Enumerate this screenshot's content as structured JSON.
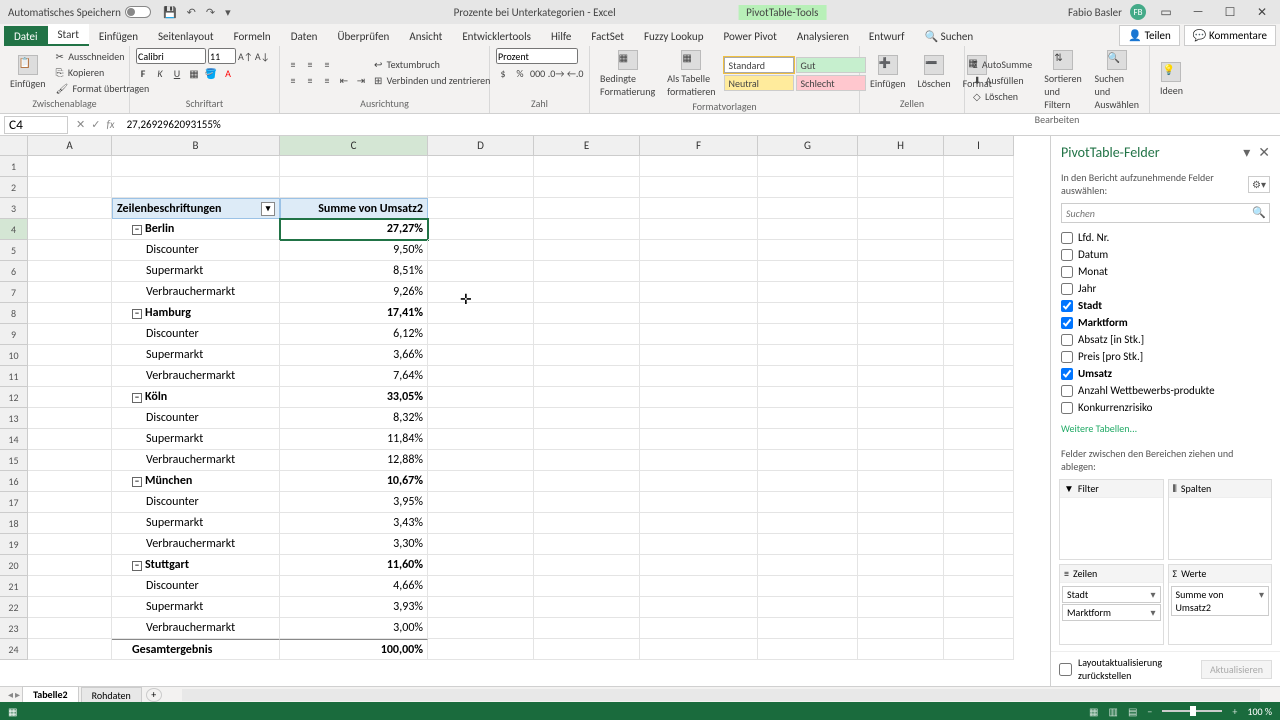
{
  "titlebar": {
    "autosave": "Automatisches Speichern",
    "doc_title": "Prozente bei Unterkategorien - Excel",
    "tools_tab": "PivotTable-Tools",
    "user_name": "Fabio Basler",
    "user_initials": "FB"
  },
  "tabs": {
    "file": "Datei",
    "start": "Start",
    "einfuegen": "Einfügen",
    "seitenlayout": "Seitenlayout",
    "formeln": "Formeln",
    "daten": "Daten",
    "ueberpruefen": "Überprüfen",
    "ansicht": "Ansicht",
    "entwicklertools": "Entwicklertools",
    "hilfe": "Hilfe",
    "factset": "FactSet",
    "fuzzy": "Fuzzy Lookup",
    "powerpivot": "Power Pivot",
    "analysieren": "Analysieren",
    "entwurf": "Entwurf",
    "suchen_ph": "Suchen",
    "teilen": "Teilen",
    "kommentare": "Kommentare"
  },
  "ribbon": {
    "clipboard": {
      "paste": "Einfügen",
      "cut": "Ausschneiden",
      "copy": "Kopieren",
      "format": "Format übertragen",
      "label": "Zwischenablage"
    },
    "font": {
      "name": "Calibri",
      "size": "11",
      "label": "Schriftart"
    },
    "align": {
      "wrap": "Textumbruch",
      "merge": "Verbinden und zentrieren",
      "label": "Ausrichtung"
    },
    "number": {
      "format": "Prozent",
      "label": "Zahl"
    },
    "cond": {
      "bedingte": "Bedingte Formatierung",
      "alstabelle": "Als Tabelle formatieren",
      "label": "Formatvorlagen"
    },
    "styles": {
      "standard": "Standard",
      "gut": "Gut",
      "neutral": "Neutral",
      "schlecht": "Schlecht"
    },
    "cells": {
      "einfuegen": "Einfügen",
      "loeschen": "Löschen",
      "format": "Format",
      "label": "Zellen"
    },
    "editing": {
      "autosumme": "AutoSumme",
      "ausfuellen": "Ausfüllen",
      "loeschen": "Löschen",
      "sortieren": "Sortieren und Filtern",
      "suchen": "Suchen und Auswählen",
      "label": "Bearbeiten"
    },
    "ideen": "Ideen"
  },
  "fx": {
    "namebox": "C4",
    "formula": "27,2692962093155%"
  },
  "columns": [
    "A",
    "B",
    "C",
    "D",
    "E",
    "F",
    "G",
    "H",
    "I"
  ],
  "pivot": {
    "header_b": "Zeilenbeschriftungen",
    "header_c": "Summe von Umsatz2",
    "rows": [
      {
        "r": 4,
        "type": "city",
        "label": "Berlin",
        "val": "27,27%",
        "sel": true
      },
      {
        "r": 5,
        "type": "sub",
        "label": "Discounter",
        "val": "9,50%"
      },
      {
        "r": 6,
        "type": "sub",
        "label": "Supermarkt",
        "val": "8,51%"
      },
      {
        "r": 7,
        "type": "sub",
        "label": "Verbrauchermarkt",
        "val": "9,26%"
      },
      {
        "r": 8,
        "type": "city",
        "label": "Hamburg",
        "val": "17,41%"
      },
      {
        "r": 9,
        "type": "sub",
        "label": "Discounter",
        "val": "6,12%"
      },
      {
        "r": 10,
        "type": "sub",
        "label": "Supermarkt",
        "val": "3,66%"
      },
      {
        "r": 11,
        "type": "sub",
        "label": "Verbrauchermarkt",
        "val": "7,64%"
      },
      {
        "r": 12,
        "type": "city",
        "label": "Köln",
        "val": "33,05%"
      },
      {
        "r": 13,
        "type": "sub",
        "label": "Discounter",
        "val": "8,32%"
      },
      {
        "r": 14,
        "type": "sub",
        "label": "Supermarkt",
        "val": "11,84%"
      },
      {
        "r": 15,
        "type": "sub",
        "label": "Verbrauchermarkt",
        "val": "12,88%"
      },
      {
        "r": 16,
        "type": "city",
        "label": "München",
        "val": "10,67%"
      },
      {
        "r": 17,
        "type": "sub",
        "label": "Discounter",
        "val": "3,95%"
      },
      {
        "r": 18,
        "type": "sub",
        "label": "Supermarkt",
        "val": "3,43%"
      },
      {
        "r": 19,
        "type": "sub",
        "label": "Verbrauchermarkt",
        "val": "3,30%"
      },
      {
        "r": 20,
        "type": "city",
        "label": "Stuttgart",
        "val": "11,60%"
      },
      {
        "r": 21,
        "type": "sub",
        "label": "Discounter",
        "val": "4,66%"
      },
      {
        "r": 22,
        "type": "sub",
        "label": "Supermarkt",
        "val": "3,93%"
      },
      {
        "r": 23,
        "type": "sub",
        "label": "Verbrauchermarkt",
        "val": "3,00%"
      },
      {
        "r": 24,
        "type": "total",
        "label": "Gesamtergebnis",
        "val": "100,00%"
      }
    ]
  },
  "fieldpane": {
    "title": "PivotTable-Felder",
    "subtitle": "In den Bericht aufzunehmende Felder auswählen:",
    "search_ph": "Suchen",
    "fields": [
      {
        "name": "Lfd. Nr.",
        "checked": false
      },
      {
        "name": "Datum",
        "checked": false
      },
      {
        "name": "Monat",
        "checked": false
      },
      {
        "name": "Jahr",
        "checked": false
      },
      {
        "name": "Stadt",
        "checked": true
      },
      {
        "name": "Marktform",
        "checked": true
      },
      {
        "name": "Absatz [in Stk.]",
        "checked": false
      },
      {
        "name": "Preis [pro Stk.]",
        "checked": false
      },
      {
        "name": "Umsatz",
        "checked": true
      },
      {
        "name": "Anzahl Wettbewerbs-produkte",
        "checked": false
      },
      {
        "name": "Konkurrenzrisiko",
        "checked": false
      }
    ],
    "more_tables": "Weitere Tabellen...",
    "drag_label": "Felder zwischen den Bereichen ziehen und ablegen:",
    "area_filter": "Filter",
    "area_columns": "Spalten",
    "area_rows": "Zeilen",
    "area_values": "Werte",
    "row_items": [
      "Stadt",
      "Marktform"
    ],
    "val_items": [
      "Summe von Umsatz2"
    ],
    "defer": "Layoutaktualisierung zurückstellen",
    "update": "Aktualisieren"
  },
  "sheets": {
    "active": "Tabelle2",
    "other": "Rohdaten"
  },
  "status": {
    "zoom": "100 %"
  }
}
